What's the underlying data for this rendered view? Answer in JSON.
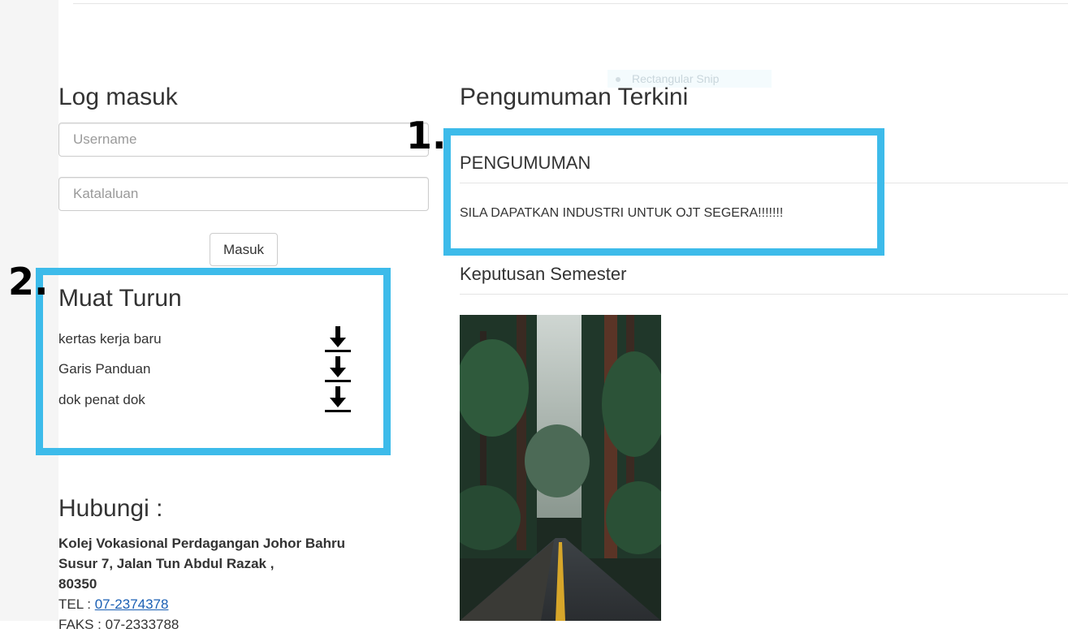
{
  "login": {
    "heading": "Log masuk",
    "username_placeholder": "Username",
    "password_placeholder": "Katalaluan",
    "submit_label": "Masuk"
  },
  "downloads": {
    "heading": "Muat Turun",
    "items": [
      {
        "label": "kertas kerja baru",
        "icon": "download-icon"
      },
      {
        "label": "Garis Panduan",
        "icon": "download-icon"
      },
      {
        "label": "dok penat dok",
        "icon": "download-icon"
      }
    ]
  },
  "contact": {
    "heading": "Hubungi :",
    "address_lines": [
      "Kolej Vokasional Perdagangan Johor Bahru",
      "Susur 7, Jalan Tun Abdul Razak ,",
      "80350"
    ],
    "tel_label": "TEL : ",
    "tel_value": "07-2374378",
    "fax_text": "FAKS : 07-2333788"
  },
  "announcements": {
    "heading": "Pengumuman Terkini",
    "panel_title": "PENGUMUMAN",
    "message": "SILA DAPATKAN INDUSTRI UNTUK OJT SEGERA!!!!!!!"
  },
  "results": {
    "heading": "Keputusan Semester"
  },
  "overlay": {
    "snip_tooltip": "Rectangular Snip",
    "callout_1": "1.",
    "callout_2": "2.",
    "callout_color": "#3dbbea"
  }
}
